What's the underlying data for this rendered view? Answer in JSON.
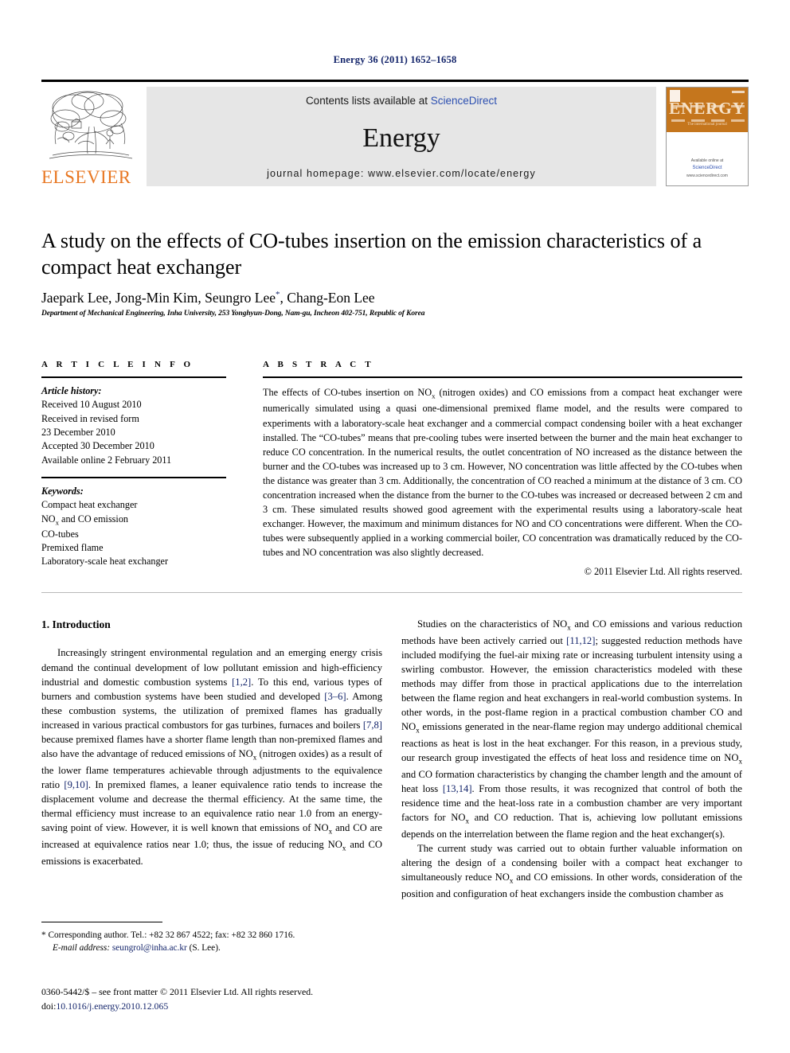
{
  "running_head": "Energy 36 (2011) 1652–1658",
  "masthead": {
    "contents_prefix": "Contents lists available at ",
    "sciencedirect": "ScienceDirect",
    "journal_title": "Energy",
    "homepage": "journal homepage: www.elsevier.com/locate/energy",
    "publisher_wordmark": "ELSEVIER",
    "cover": {
      "title": "ENERGY",
      "subtitle": "The international journal",
      "footer_line1": "Available online at",
      "footer_badge": "ScienceDirect",
      "footer_line2": "www.sciencedirect.com",
      "band_color": "#c5761d"
    },
    "link_color": "#2c4fb0",
    "band_bg": "#e6e6e6"
  },
  "article": {
    "title": "A study on the effects of CO-tubes insertion on the emission characteristics of a compact heat exchanger",
    "authors_pre": "Jaepark Lee, Jong-Min Kim, Seungro Lee",
    "author_marker": "*",
    "authors_post": ", Chang-Eon Lee",
    "affiliation": "Department of Mechanical Engineering, Inha University, 253 Yonghyun-Dong, Nam-gu, Incheon 402-751, Republic of Korea"
  },
  "info": {
    "heading": "A R T I C L E   I N F O",
    "history_label": "Article history:",
    "history": [
      "Received 10 August 2010",
      "Received in revised form",
      "23 December 2010",
      "Accepted 30 December 2010",
      "Available online 2 February 2011"
    ],
    "keywords_label": "Keywords:",
    "keywords_line1": "Compact heat exchanger",
    "keywords_line2_pre": "NO",
    "keywords_line2_sub": "x",
    "keywords_line2_post": " and CO emission",
    "keywords_line3": "CO-tubes",
    "keywords_line4": "Premixed flame",
    "keywords_line5": "Laboratory-scale heat exchanger"
  },
  "abstract": {
    "heading": "A B S T R A C T",
    "p1_a": "The effects of CO-tubes insertion on NO",
    "p1_sub": "x",
    "p1_b": " (nitrogen oxides) and CO emissions from a compact heat exchanger were numerically simulated using a quasi one-dimensional premixed flame model, and the results were compared to experiments with a laboratory-scale heat exchanger and a commercial compact condensing boiler with a heat exchanger installed. The “CO-tubes” means that pre-cooling tubes were inserted between the burner and the main heat exchanger to reduce CO concentration. In the numerical results, the outlet concentration of NO increased as the distance between the burner and the CO-tubes was increased up to 3 cm. However, NO concentration was little affected by the CO-tubes when the distance was greater than 3 cm. Additionally, the concentration of CO reached a minimum at the distance of 3 cm. CO concentration increased when the distance from the burner to the CO-tubes was increased or decreased between 2 cm and 3 cm. These simulated results showed good agreement with the experimental results using a laboratory-scale heat exchanger. However, the maximum and minimum distances for NO and CO concentrations were different. When the CO-tubes were subsequently applied in a working commercial boiler, CO concentration was dramatically reduced by the CO-tubes and NO concentration was also slightly decreased.",
    "copyright": "© 2011 Elsevier Ltd. All rights reserved."
  },
  "body": {
    "section_number_title": "1. Introduction",
    "left_p1_a": "Increasingly stringent environmental regulation and an emerging energy crisis demand the continual development of low pollutant emission and high-efficiency industrial and domestic combustion systems ",
    "left_p1_ref1": "[1,2]",
    "left_p1_b": ". To this end, various types of burners and combustion systems have been studied and developed ",
    "left_p1_ref2": "[3–6]",
    "left_p1_c": ". Among these combustion systems, the utilization of premixed flames has gradually increased in various practical combustors for gas turbines, furnaces and boilers ",
    "left_p1_ref3": "[7,8]",
    "left_p1_d": " because premixed flames have a shorter flame length than non-premixed flames and also have the advantage of reduced emissions of NO",
    "left_p1_sub1": "x",
    "left_p1_e": " (nitrogen oxides) as a result of the lower flame temperatures achievable through adjustments to the equivalence ratio ",
    "left_p1_ref4": "[9,10]",
    "left_p1_f": ". In premixed flames, a leaner equivalence ratio tends to increase the displacement volume and decrease the thermal efficiency. At the same time, the thermal efficiency must increase to an equivalence ratio near 1.0 from an energy-saving point of view. However, it is well known that emissions of NO",
    "left_p1_sub2": "x",
    "left_p1_g": " and CO are increased at equivalence ratios near 1.0; thus, the issue of reducing NO",
    "left_p1_sub3": "x",
    "left_p1_h": " and CO emissions is exacerbated.",
    "right_p1_a": "Studies on the characteristics of NO",
    "right_p1_sub1": "x",
    "right_p1_b": " and CO emissions and various reduction methods have been actively carried out ",
    "right_p1_ref1": "[11,12]",
    "right_p1_c": "; suggested reduction methods have included modifying the fuel-air mixing rate or increasing turbulent intensity using a swirling combustor. However, the emission characteristics modeled with these methods may differ from those in practical applications due to the interrelation between the flame region and heat exchangers in real-world combustion systems. In other words, in the post-flame region in a practical combustion chamber CO and NO",
    "right_p1_sub2": "x",
    "right_p1_d": " emissions generated in the near-flame region may undergo additional chemical reactions as heat is lost in the heat exchanger. For this reason, in a previous study, our research group investigated the effects of heat loss and residence time on NO",
    "right_p1_sub3": "x",
    "right_p1_e": " and CO formation characteristics by changing the chamber length and the amount of heat loss ",
    "right_p1_ref2": "[13,14]",
    "right_p1_f": ". From those results, it was recognized that control of both the residence time and the heat-loss rate in a combustion chamber are very important factors for NO",
    "right_p1_sub4": "x",
    "right_p1_g": " and CO reduction. That is, achieving low pollutant emissions depends on the interrelation between the flame region and the heat exchanger(s).",
    "right_p2_a": "The current study was carried out to obtain further valuable information on altering the design of a condensing boiler with a compact heat exchanger to simultaneously reduce NO",
    "right_p2_sub1": "x",
    "right_p2_b": " and CO emissions. In other words, consideration of the position and configuration of heat exchangers inside the combustion chamber as"
  },
  "footnote": {
    "star": "*",
    "corresponding": " Corresponding author. Tel.: +82 32 867 4522; fax: +82 32 860 1716.",
    "email_label": "E-mail address:",
    "email": "seungrol@inha.ac.kr",
    "email_suffix": " (S. Lee)."
  },
  "imprint": {
    "line1": "0360-5442/$ – see front matter © 2011 Elsevier Ltd. All rights reserved.",
    "doi_label": "doi:",
    "doi_value": "10.1016/j.energy.2010.12.065"
  }
}
